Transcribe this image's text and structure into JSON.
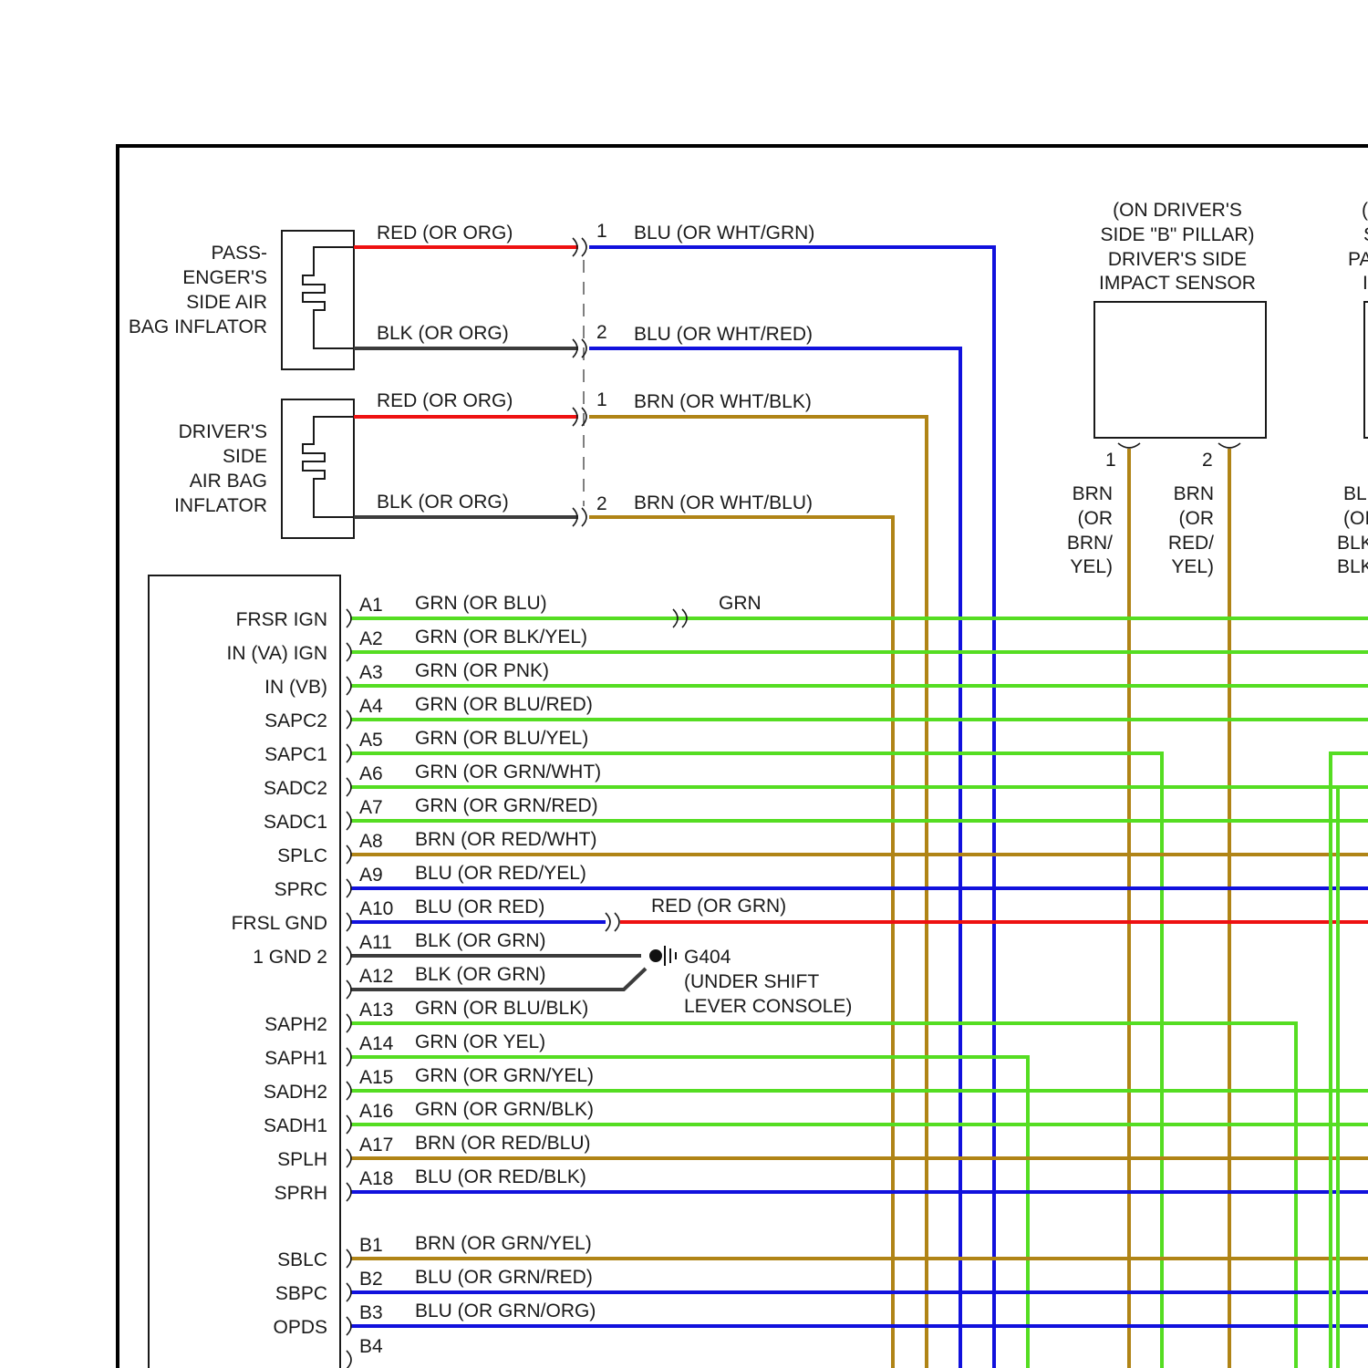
{
  "colors": {
    "red": "#ee1111",
    "blk": "#3c3c3c",
    "blu": "#1111dd",
    "brn": "#b08416",
    "grn": "#55dd22"
  },
  "passenger_inflator": {
    "label_lines": [
      "PASS-",
      "ENGER'S",
      "SIDE AIR",
      "BAG INFLATOR"
    ],
    "wire1_label": "RED (OR ORG)",
    "wire2_label": "BLK (OR ORG)",
    "pin1": "1",
    "pin2": "2",
    "out1_label": "BLU (OR WHT/GRN)",
    "out2_label": "BLU (OR WHT/RED)"
  },
  "driver_inflator": {
    "label_lines": [
      "DRIVER'S",
      "SIDE",
      "AIR BAG",
      "INFLATOR"
    ],
    "wire1_label": "RED (OR ORG)",
    "wire2_label": "BLK (OR ORG)",
    "pin1": "1",
    "pin2": "2",
    "out1_label": "BRN (OR WHT/BLK)",
    "out2_label": "BRN (OR WHT/BLU)"
  },
  "impact_sensor": {
    "label_lines": [
      "(ON DRIVER'S",
      "SIDE \"B\" PILLAR)",
      "DRIVER'S SIDE",
      "IMPACT SENSOR"
    ],
    "pin1": "1",
    "pin2": "2",
    "pin1_wire_lines": [
      "BRN",
      "(OR",
      "BRN/",
      "YEL)"
    ],
    "pin2_wire_lines": [
      "BRN",
      "(OR",
      "RED/",
      "YEL)"
    ]
  },
  "right_cutoff": {
    "label_lines": [
      "(",
      "S",
      "PA",
      "I"
    ],
    "wire_lines": [
      "BL",
      "(OI",
      "BLK",
      "BLK"
    ]
  },
  "module_pins": [
    {
      "name": "FRSR IGN",
      "pin": "A1",
      "wire": "GRN (OR BLU)",
      "color": "grn"
    },
    {
      "name": "IN (VA) IGN",
      "pin": "A2",
      "wire": "GRN (OR BLK/YEL)",
      "color": "grn"
    },
    {
      "name": "IN (VB)",
      "pin": "A3",
      "wire": "GRN (OR PNK)",
      "color": "grn"
    },
    {
      "name": "SAPC2",
      "pin": "A4",
      "wire": "GRN (OR BLU/RED)",
      "color": "grn"
    },
    {
      "name": "SAPC1",
      "pin": "A5",
      "wire": "GRN (OR BLU/YEL)",
      "color": "grn"
    },
    {
      "name": "SADC2",
      "pin": "A6",
      "wire": "GRN (OR GRN/WHT)",
      "color": "grn"
    },
    {
      "name": "SADC1",
      "pin": "A7",
      "wire": "GRN (OR GRN/RED)",
      "color": "grn"
    },
    {
      "name": "SPLC",
      "pin": "A8",
      "wire": "BRN (OR RED/WHT)",
      "color": "brn"
    },
    {
      "name": "SPRC",
      "pin": "A9",
      "wire": "BLU (OR RED/YEL)",
      "color": "blu"
    },
    {
      "name": "FRSL GND",
      "pin": "A10",
      "wire": "BLU (OR RED)",
      "color": "blu"
    },
    {
      "name": "1 GND 2",
      "pin": "A11",
      "wire": "BLK (OR GRN)",
      "color": "blk"
    },
    {
      "name": "",
      "pin": "A12",
      "wire": "BLK (OR GRN)",
      "color": "blk"
    },
    {
      "name": "SAPH2",
      "pin": "A13",
      "wire": "GRN (OR BLU/BLK)",
      "color": "grn"
    },
    {
      "name": "SAPH1",
      "pin": "A14",
      "wire": "GRN (OR YEL)",
      "color": "grn"
    },
    {
      "name": "SADH2",
      "pin": "A15",
      "wire": "GRN (OR GRN/YEL)",
      "color": "grn"
    },
    {
      "name": "SADH1",
      "pin": "A16",
      "wire": "GRN (OR GRN/BLK)",
      "color": "grn"
    },
    {
      "name": "SPLH",
      "pin": "A17",
      "wire": "BRN (OR RED/BLU)",
      "color": "brn"
    },
    {
      "name": "SPRH",
      "pin": "A18",
      "wire": "BLU (OR RED/BLK)",
      "color": "blu"
    },
    {
      "name": "SBLC",
      "pin": "B1",
      "wire": "BRN (OR GRN/YEL)",
      "color": "brn"
    },
    {
      "name": "SBPC",
      "pin": "B2",
      "wire": "BLU (OR GRN/RED)",
      "color": "blu"
    },
    {
      "name": "OPDS",
      "pin": "B3",
      "wire": "BLU (OR GRN/ORG)",
      "color": "blu"
    },
    {
      "name": "",
      "pin": "B4",
      "wire": "",
      "color": ""
    }
  ],
  "a1_extension_label": "GRN",
  "a10_extension_label": "RED (OR GRN)",
  "ground": {
    "id": "G404",
    "location_lines": [
      "(UNDER SHIFT",
      "LEVER CONSOLE)"
    ]
  }
}
